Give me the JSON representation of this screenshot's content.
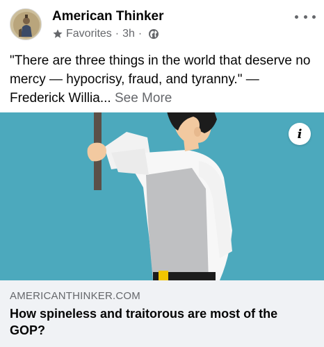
{
  "post": {
    "page_name": "American Thinker",
    "audience": "Favorites",
    "time": "3h",
    "separator": "·",
    "text_main": "\"There are three things in the world that deserve no mercy — hypocrisy, fraud, and tyranny.\" — Frederick Willia...",
    "see_more": "See More"
  },
  "link": {
    "domain": "AMERICANTHINKER.COM",
    "title": "How spineless and traitorous are most of the GOP?",
    "info_label": "i"
  },
  "icons": {
    "star": "star-icon",
    "globe": "globe-icon",
    "more": "more-options-icon",
    "info": "info-icon"
  },
  "colors": {
    "text": "#050505",
    "secondary": "#65676b",
    "image_bg": "#4ca9bd",
    "footer_bg": "#f0f2f5"
  }
}
